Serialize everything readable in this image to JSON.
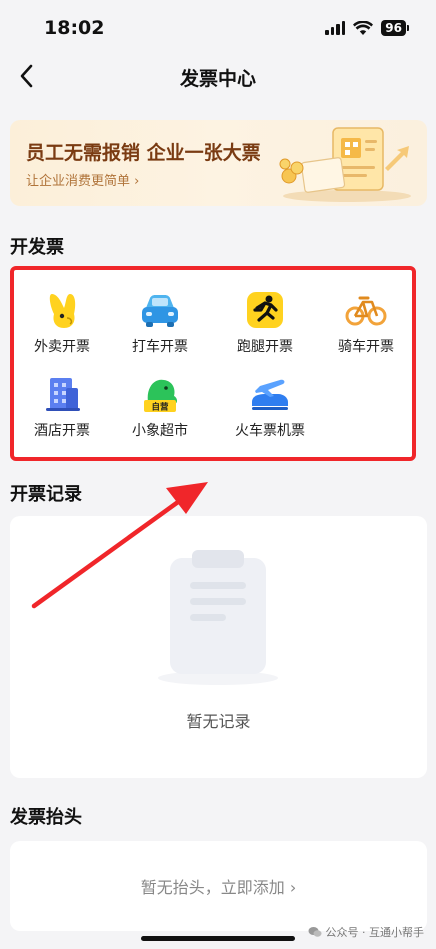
{
  "status_bar": {
    "time": "18:02",
    "battery": "96"
  },
  "nav": {
    "title": "发票中心"
  },
  "banner": {
    "title": "员工无需报销 企业一张大票",
    "subtitle": "让企业消费更简单 ›"
  },
  "sections": {
    "issue_title": "开发票",
    "records_title": "开票记录",
    "header_title": "发票抬头"
  },
  "services": [
    {
      "label": "外卖开票",
      "icon": "kangaroo-icon"
    },
    {
      "label": "打车开票",
      "icon": "car-icon"
    },
    {
      "label": "跑腿开票",
      "icon": "runner-icon"
    },
    {
      "label": "骑车开票",
      "icon": "bicycle-icon"
    },
    {
      "label": "酒店开票",
      "icon": "hotel-icon"
    },
    {
      "label": "小象超市",
      "icon": "elephant-icon",
      "badge": "自营"
    },
    {
      "label": "火车票机票",
      "icon": "plane-train-icon"
    }
  ],
  "records": {
    "empty_text": "暂无记录"
  },
  "invoice_header": {
    "empty_text": "暂无抬头，立即添加 ›"
  },
  "watermark": {
    "text": "公众号 · 互通小帮手"
  },
  "colors": {
    "background": "#f4f4f6",
    "highlight_border": "#f0262a",
    "banner_title": "#7a3b12",
    "brand_yellow": "#ffd21f"
  }
}
